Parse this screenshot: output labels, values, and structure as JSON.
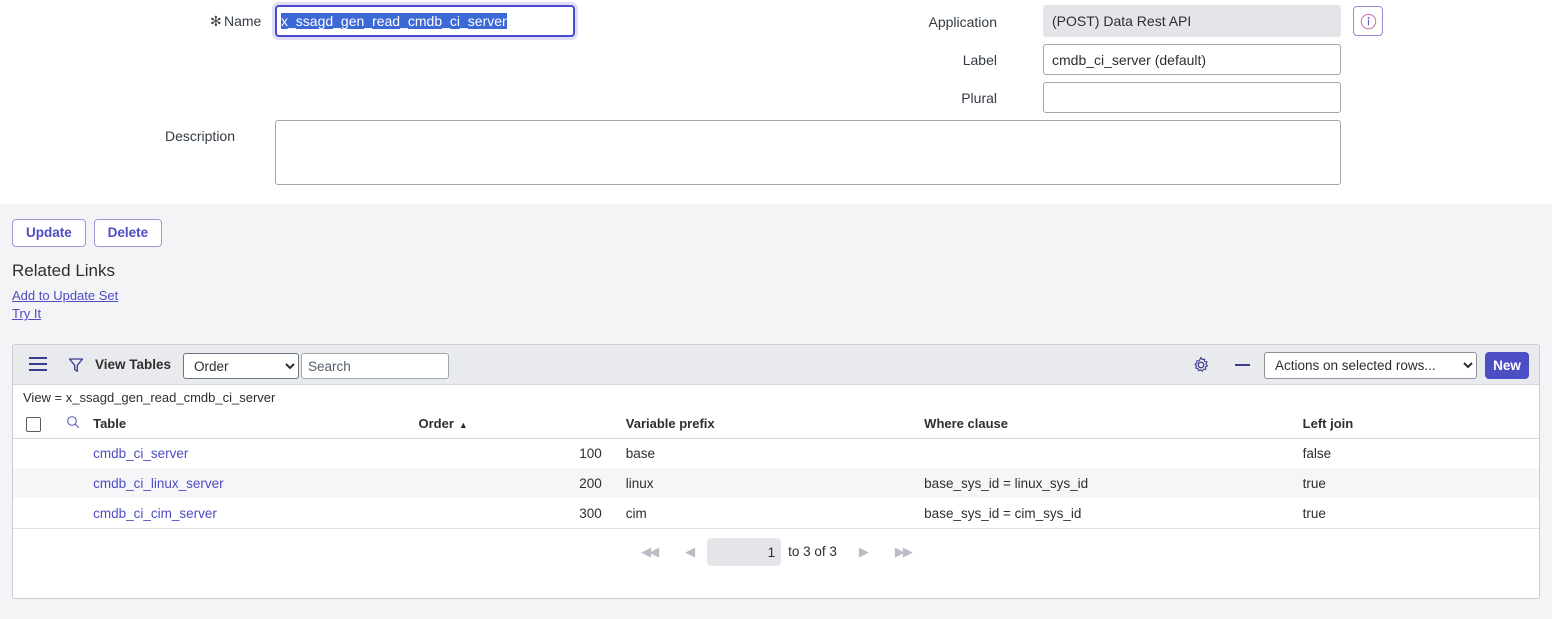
{
  "form": {
    "name": {
      "label": "Name",
      "required_marker": "✻",
      "value": "x_ssagd_gen_read_cmdb_ci_server",
      "placeholder": ""
    },
    "application": {
      "label": "Application",
      "value": "(POST) Data Rest API",
      "info_icon": "info-circle-icon"
    },
    "field_label": {
      "label": "Label",
      "value": "cmdb_ci_server (default)",
      "placeholder": ""
    },
    "plural": {
      "label": "Plural",
      "value": "",
      "placeholder": ""
    },
    "description": {
      "label": "Description",
      "value": "",
      "placeholder": ""
    }
  },
  "actions": {
    "update_label": "Update",
    "delete_label": "Delete"
  },
  "related_links": {
    "title": "Related Links",
    "links": [
      {
        "label": "Add to Update Set"
      },
      {
        "label": "Try It"
      }
    ]
  },
  "list": {
    "toolbar": {
      "menu_icon": "hamburger-menu-icon",
      "filter_icon": "filter-funnel-icon",
      "title": "View Tables",
      "order_select_value": "Order",
      "order_select_options": [
        "Order"
      ],
      "search_placeholder": "Search",
      "search_value": "",
      "gear_icon": "gear-icon",
      "collapse_icon": "minus-icon",
      "actions_select_value": "Actions on selected rows...",
      "actions_select_options": [
        "Actions on selected rows..."
      ],
      "new_label": "New"
    },
    "breadcrumb": "View = x_ssagd_gen_read_cmdb_ci_server",
    "columns": [
      {
        "key": "table",
        "label": "Table",
        "sorted": false
      },
      {
        "key": "order",
        "label": "Order",
        "sorted": true,
        "sort_dir": "asc",
        "sort_glyph": "▲"
      },
      {
        "key": "variable_prefix",
        "label": "Variable prefix",
        "sorted": false
      },
      {
        "key": "where_clause",
        "label": "Where clause",
        "sorted": false
      },
      {
        "key": "left_join",
        "label": "Left join",
        "sorted": false
      }
    ],
    "rows": [
      {
        "table": "cmdb_ci_server",
        "order": "100",
        "variable_prefix": "base",
        "where_clause": "",
        "left_join": "false"
      },
      {
        "table": "cmdb_ci_linux_server",
        "order": "200",
        "variable_prefix": "linux",
        "where_clause": "base_sys_id = linux_sys_id",
        "left_join": "true"
      },
      {
        "table": "cmdb_ci_cim_server",
        "order": "300",
        "variable_prefix": "cim",
        "where_clause": "base_sys_id = cim_sys_id",
        "left_join": "true"
      }
    ],
    "pager": {
      "first_icon": "◀◀",
      "prev_icon": "◀",
      "page_number": "1",
      "range_text": "to 3 of 3",
      "next_icon": "▶",
      "last_icon": "▶▶"
    }
  },
  "colors": {
    "accent": "#4d4dc4",
    "focus_border": "#4a4ad1",
    "selection": "#3d69d6",
    "toolbar_bg": "#e9eaee",
    "page_bg": "#f4f4f6",
    "row_alt_bg": "#f6f6f8"
  }
}
